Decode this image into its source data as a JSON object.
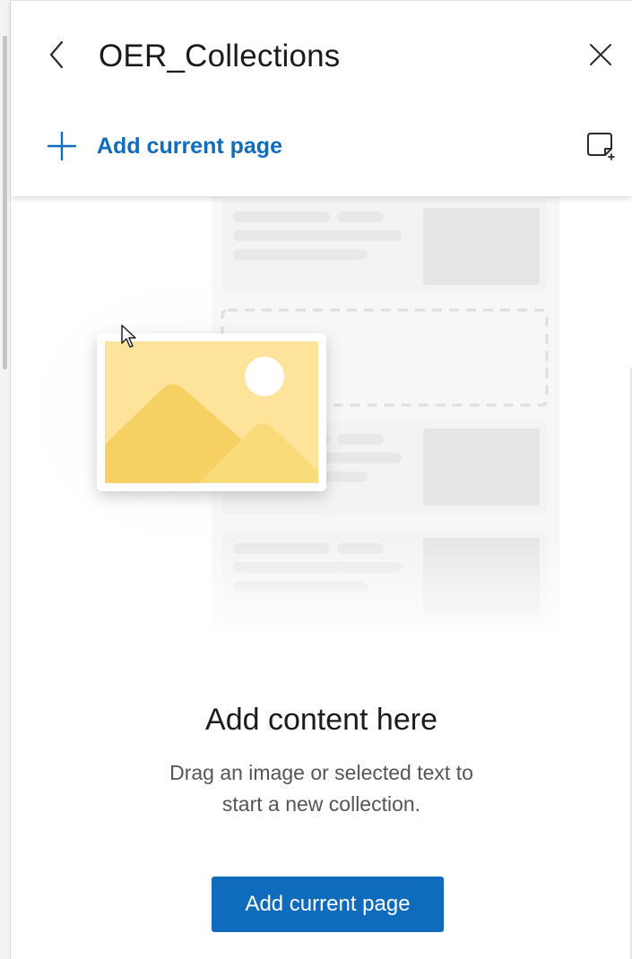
{
  "panel": {
    "title": "OER_Collections",
    "add_link_label": "Add current page",
    "back_icon": "chevron-left-icon",
    "close_icon": "close-icon",
    "note_icon": "add-note-icon"
  },
  "empty_state": {
    "heading": "Add content here",
    "description_line1": "Drag an image or selected text to",
    "description_line2": "start a new collection.",
    "button_label": "Add current page"
  },
  "colors": {
    "accent": "#0f6cbd",
    "illustration_yellow": "#fde49a",
    "illustration_dark_yellow": "#f7d064"
  }
}
